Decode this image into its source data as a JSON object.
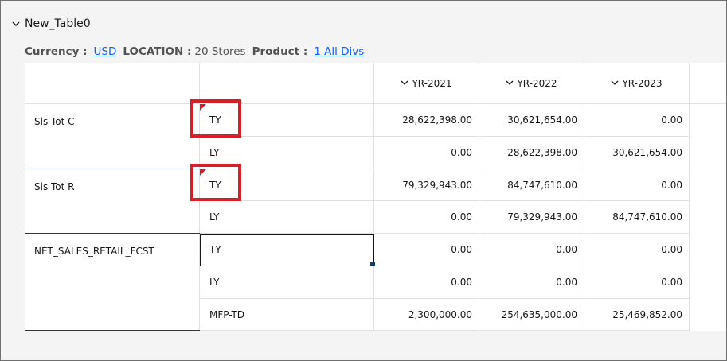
{
  "panel": {
    "title": "New_Table0"
  },
  "filters": {
    "currency_label": "Currency :",
    "currency_value": "USD",
    "location_label": "LOCATION :",
    "location_value": "20 Stores",
    "product_label": "Product :",
    "product_value": "1 All Divs"
  },
  "table": {
    "columns": [
      "YR-2021",
      "YR-2022",
      "YR-2023"
    ],
    "groups": [
      {
        "name": "Sls Tot C",
        "rows": [
          {
            "measure": "TY",
            "values": [
              "28,622,398.00",
              "30,621,654.00",
              "0.00"
            ]
          },
          {
            "measure": "LY",
            "values": [
              "0.00",
              "28,622,398.00",
              "30,621,654.00"
            ]
          }
        ]
      },
      {
        "name": "Sls Tot R",
        "rows": [
          {
            "measure": "TY",
            "values": [
              "79,329,943.00",
              "84,747,610.00",
              "0.00"
            ]
          },
          {
            "measure": "LY",
            "values": [
              "0.00",
              "79,329,943.00",
              "84,747,610.00"
            ]
          }
        ]
      },
      {
        "name": "NET_SALES_RETAIL_FCST",
        "rows": [
          {
            "measure": "TY",
            "values": [
              "0.00",
              "0.00",
              "0.00"
            ]
          },
          {
            "measure": "LY",
            "values": [
              "0.00",
              "0.00",
              "0.00"
            ]
          },
          {
            "measure": "MFP-TD",
            "values": [
              "2,300,000.00",
              "254,635,000.00",
              "25,469,852.00"
            ]
          }
        ]
      }
    ]
  },
  "colors": {
    "link": "#0f62fe",
    "highlight": "#da1e28",
    "group_separator": "#1d3c5e"
  },
  "icons": {
    "collapse": "chevron-down-icon",
    "column_sort": "chevron-down-icon"
  }
}
